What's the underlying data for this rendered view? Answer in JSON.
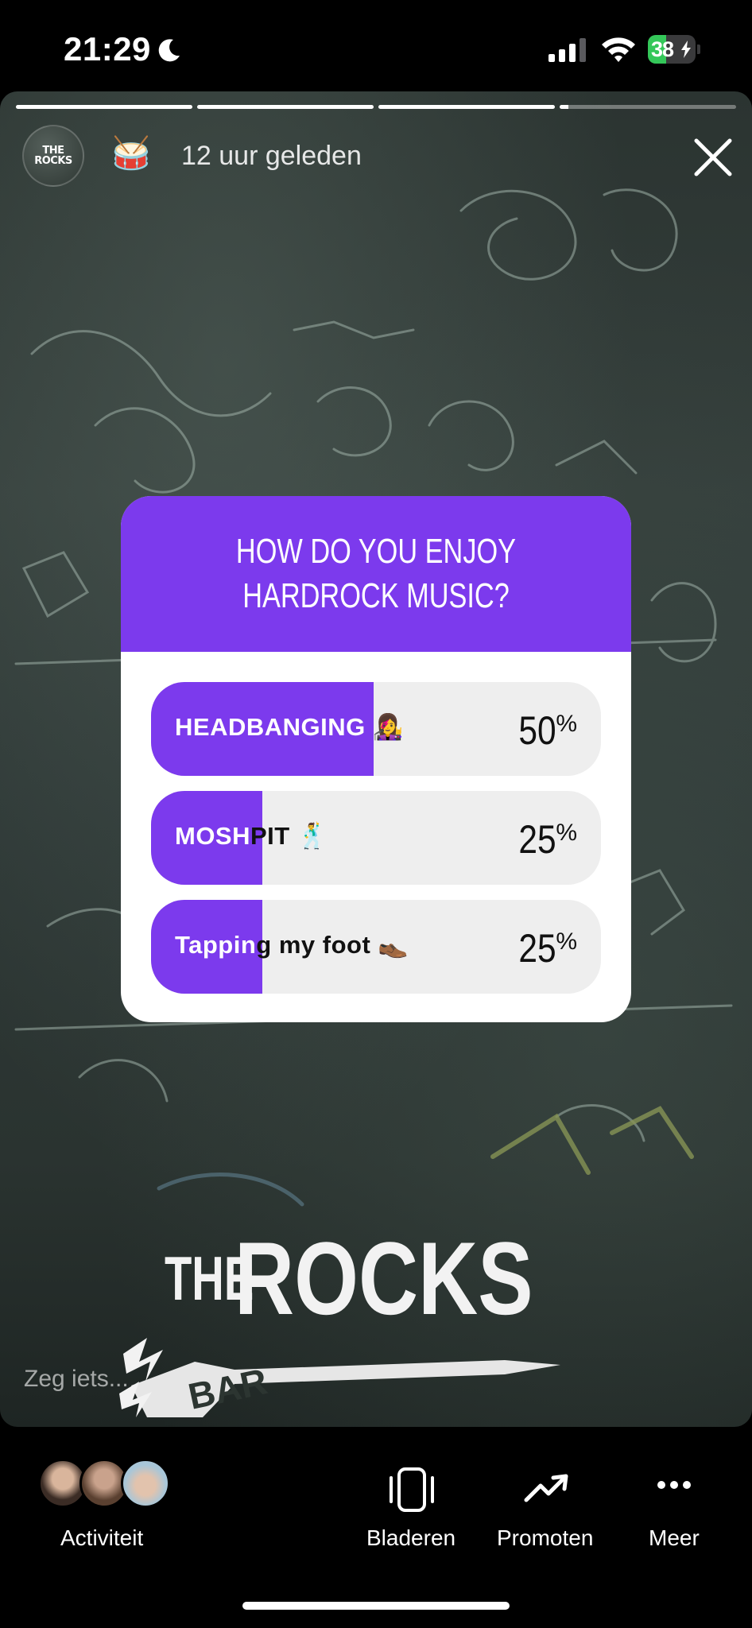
{
  "status_bar": {
    "time": "21:29",
    "battery_level": "38",
    "battery_fraction": 0.38
  },
  "story": {
    "progress_segments": [
      1,
      1,
      1,
      0.05
    ],
    "account_avatar_text": "THE ROCKS",
    "emoji": "🥁",
    "time_ago": "12 uur geleden",
    "reply_placeholder": "Zeg iets...",
    "logo": {
      "line1": "THE",
      "line2": "ROCKS",
      "line3": "BAR"
    }
  },
  "poll": {
    "question": "HOW DO YOU ENJOY HARDROCK MUSIC?",
    "accent_color": "#7c3aed",
    "options": [
      {
        "label": "HEADBANGING",
        "emoji": "👩‍🎤",
        "percent": 50,
        "percent_text": "50"
      },
      {
        "label": "MOSHPIT",
        "emoji": "🕺",
        "percent": 25,
        "percent_text": "25"
      },
      {
        "label": "Tapping my foot",
        "emoji": "👞",
        "percent": 25,
        "percent_text": "25"
      }
    ],
    "percent_sign": "%"
  },
  "bottom_nav": {
    "activity": {
      "label": "Activiteit",
      "icon": "viewer-avatars"
    },
    "browse": {
      "label": "Bladeren",
      "icon": "phone-outline-icon"
    },
    "promote": {
      "label": "Promoten",
      "icon": "trending-up-icon"
    },
    "more": {
      "label": "Meer",
      "icon": "more-dots-icon"
    }
  }
}
